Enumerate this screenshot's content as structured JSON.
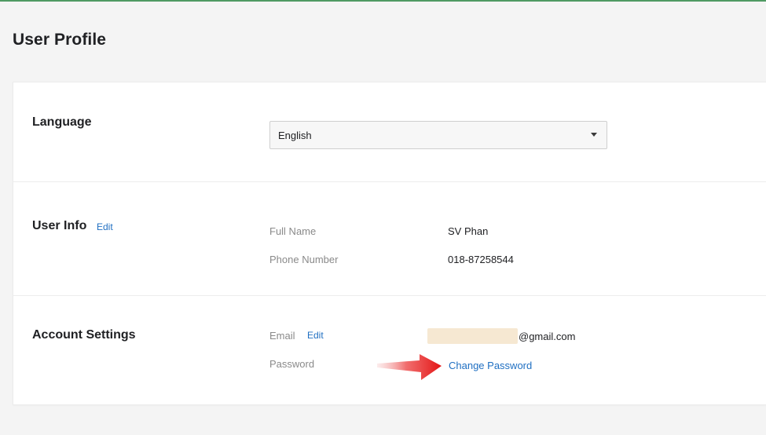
{
  "page": {
    "title": "User Profile"
  },
  "language": {
    "title": "Language",
    "selected": "English"
  },
  "user_info": {
    "title": "User Info",
    "edit_label": "Edit",
    "rows": [
      {
        "label": "Full Name",
        "value": "SV Phan"
      },
      {
        "label": "Phone Number",
        "value": "018-87258544"
      }
    ]
  },
  "account_settings": {
    "title": "Account Settings",
    "email": {
      "label": "Email",
      "edit_label": "Edit",
      "domain": "@gmail.com"
    },
    "password": {
      "label": "Password",
      "action_label": "Change Password"
    }
  },
  "colors": {
    "page_background": "#f4f4f4",
    "card_background": "#ffffff",
    "accent_green": "#4f9a63",
    "link_blue": "#1f6fc2",
    "label_gray": "#8a8a8a",
    "email_mask": "#f6e8d2",
    "annotation_red": "#e02020"
  },
  "icons": {
    "select_chevron": "chevron-down-icon",
    "annotation": "red-arrow-icon"
  }
}
